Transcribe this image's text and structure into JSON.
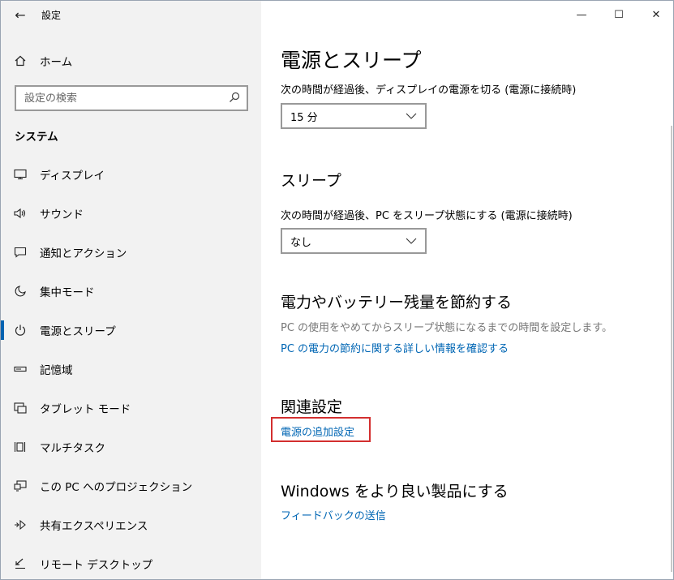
{
  "window": {
    "title": "設定",
    "back_icon": "←",
    "minimize_icon": "—",
    "maximize_icon": "☐",
    "close_icon": "✕"
  },
  "sidebar": {
    "home_label": "ホーム",
    "search_placeholder": "設定の検索",
    "section_heading": "システム",
    "items": [
      {
        "label": "ディスプレイ",
        "icon": "display-icon"
      },
      {
        "label": "サウンド",
        "icon": "speaker-icon"
      },
      {
        "label": "通知とアクション",
        "icon": "notification-icon"
      },
      {
        "label": "集中モード",
        "icon": "moon-icon"
      },
      {
        "label": "電源とスリープ",
        "icon": "power-icon",
        "selected": true
      },
      {
        "label": "記憶域",
        "icon": "storage-icon"
      },
      {
        "label": "タブレット モード",
        "icon": "tablet-icon"
      },
      {
        "label": "マルチタスク",
        "icon": "multitask-icon"
      },
      {
        "label": "この PC へのプロジェクション",
        "icon": "projection-icon"
      },
      {
        "label": "共有エクスペリエンス",
        "icon": "share-icon"
      },
      {
        "label": "リモート デスクトップ",
        "icon": "remote-desktop-icon"
      }
    ]
  },
  "main": {
    "title": "電源とスリープ",
    "screen_label": "次の時間が経過後、ディスプレイの電源を切る (電源に接続時)",
    "screen_value": "15 分",
    "sleep_heading": "スリープ",
    "sleep_label": "次の時間が経過後、PC をスリープ状態にする (電源に接続時)",
    "sleep_value": "なし",
    "battery_heading": "電力やバッテリー残量を節約する",
    "battery_desc": "PC の使用をやめてからスリープ状態になるまでの時間を設定します。",
    "battery_link": "PC の電力の節約に関する詳しい情報を確認する",
    "related_heading": "関連設定",
    "related_link": "電源の追加設定",
    "feedback_heading": "Windows をより良い製品にする",
    "feedback_link": "フィードバックの送信"
  }
}
